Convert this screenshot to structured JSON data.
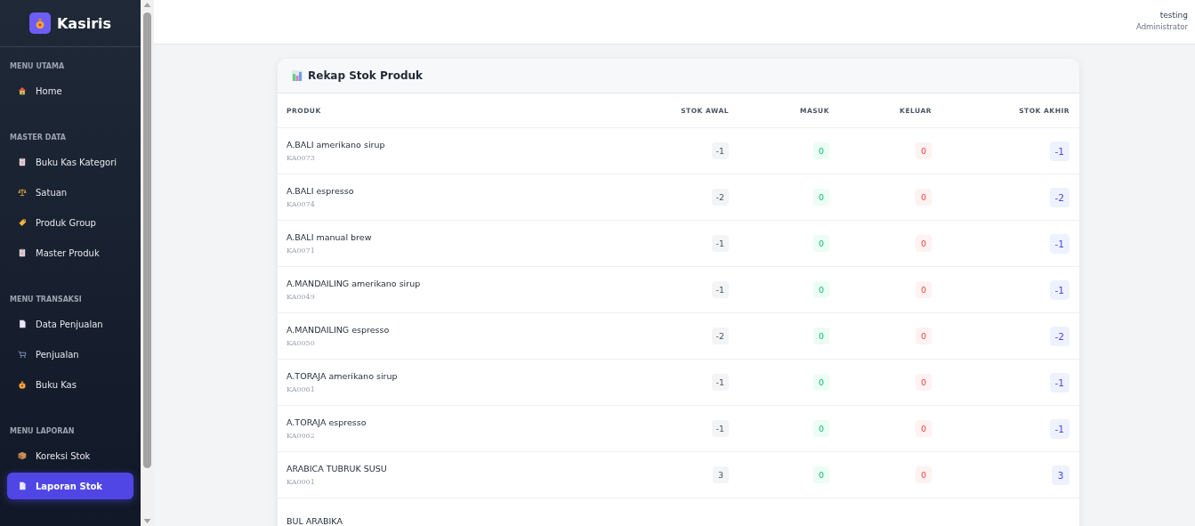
{
  "sidebar": {
    "brand": "Kasiris",
    "sections": [
      {
        "title": "MENU UTAMA",
        "items": [
          {
            "label": "Home",
            "kind": "house",
            "selected": false
          }
        ]
      },
      {
        "title": "MASTER DATA",
        "items": [
          {
            "label": "Buku Kas Kategori",
            "kind": "clipboard",
            "selected": false
          },
          {
            "label": "Satuan",
            "kind": "scale",
            "selected": false
          },
          {
            "label": "Produk Group",
            "kind": "tag",
            "selected": false
          },
          {
            "label": "Master Produk",
            "kind": "clipboard",
            "selected": false
          }
        ]
      },
      {
        "title": "MENU TRANSAKSI",
        "items": [
          {
            "label": "Data Penjualan",
            "kind": "page",
            "selected": false
          },
          {
            "label": "Penjualan",
            "kind": "cart",
            "selected": false
          },
          {
            "label": "Buku Kas",
            "kind": "bag",
            "selected": false
          }
        ]
      },
      {
        "title": "MENU LAPORAN",
        "items": [
          {
            "label": "Koreksi Stok",
            "kind": "box",
            "selected": false
          },
          {
            "label": "Laporan Stok",
            "kind": "page",
            "selected": true
          }
        ]
      }
    ]
  },
  "header": {
    "user": "testing",
    "role": "Administrator"
  },
  "card": {
    "title": "Rekap Stok Produk",
    "columns": [
      "PRODUK",
      "STOK AWAL",
      "MASUK",
      "KELUAR",
      "STOK AKHIR"
    ],
    "rows": [
      {
        "name": "A.BALI amerikano sirup",
        "code": "KA0073",
        "values": [
          "-1",
          "0",
          "0",
          "-1"
        ]
      },
      {
        "name": "A.BALI espresso",
        "code": "KA0074",
        "values": [
          "-2",
          "0",
          "0",
          "-2"
        ]
      },
      {
        "name": "A.BALI manual brew",
        "code": "KA0071",
        "values": [
          "-1",
          "0",
          "0",
          "-1"
        ]
      },
      {
        "name": "A.MANDAILING amerikano sirup",
        "code": "KA0049",
        "values": [
          "-1",
          "0",
          "0",
          "-1"
        ]
      },
      {
        "name": "A.MANDAILING espresso",
        "code": "KA0050",
        "values": [
          "-2",
          "0",
          "0",
          "-2"
        ]
      },
      {
        "name": "A.TORAJA amerikano sirup",
        "code": "KA0061",
        "values": [
          "-1",
          "0",
          "0",
          "-1"
        ]
      },
      {
        "name": "A.TORAJA espresso",
        "code": "KA0062",
        "values": [
          "-1",
          "0",
          "0",
          "-1"
        ]
      },
      {
        "name": "ARABICA TUBRUK SUSU",
        "code": "KA0001",
        "values": [
          "3",
          "0",
          "0",
          "3"
        ]
      },
      {
        "name": "BUL ARABIKA"
      }
    ]
  }
}
